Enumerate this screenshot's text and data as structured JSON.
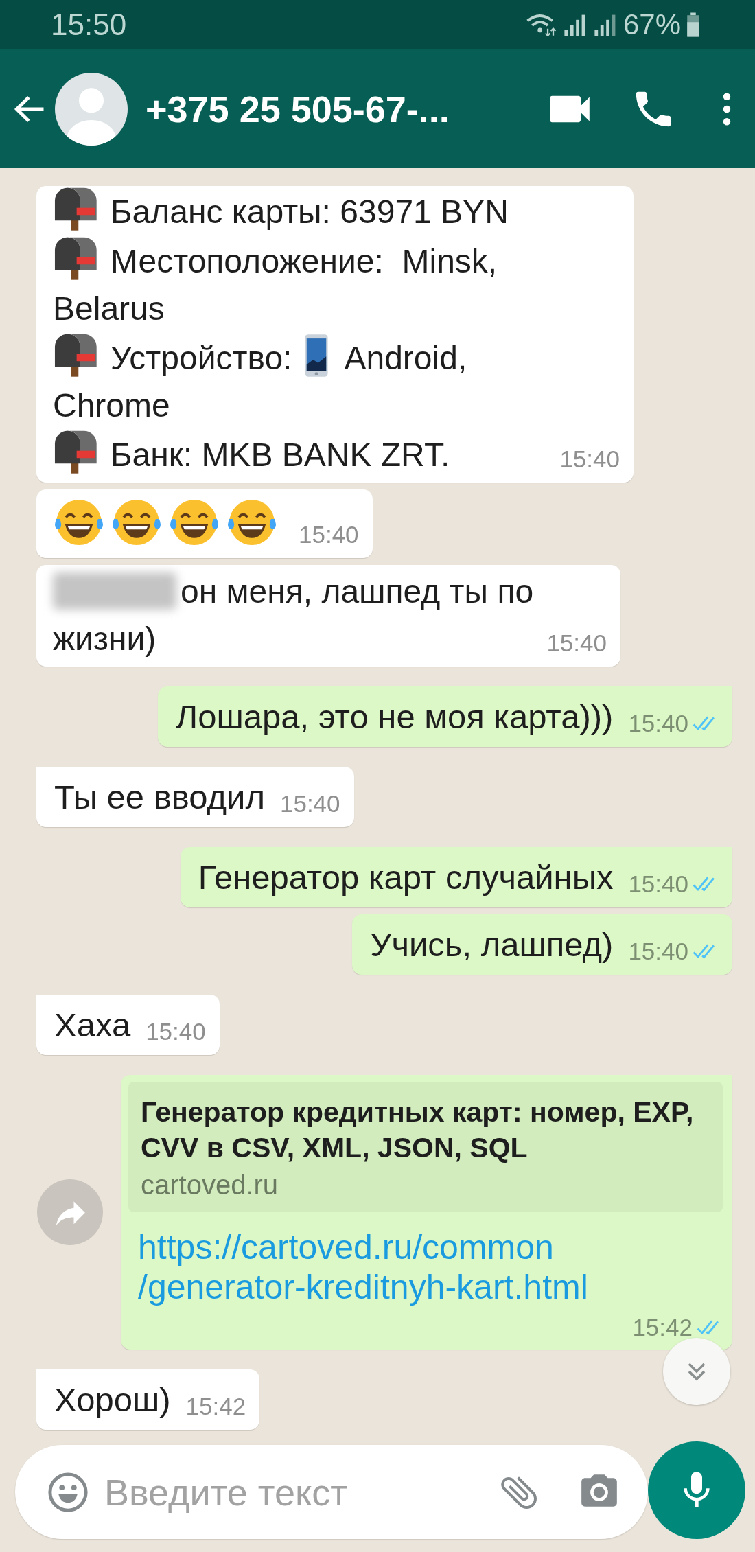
{
  "status_bar": {
    "time": "15:50",
    "battery": "67%"
  },
  "header": {
    "title": "+375 25 505-67-..."
  },
  "messages": [
    {
      "kind": "rich",
      "outgoing": false,
      "tail": false,
      "time": "15:40",
      "lines": [
        {
          "parts": [
            {
              "kind": "mailbox"
            },
            {
              "kind": "text",
              "text": "Баланс карты: 63971 BYN"
            }
          ]
        },
        {
          "parts": [
            {
              "kind": "mailbox"
            },
            {
              "kind": "text",
              "text": "Местоположение:  Minsk,"
            }
          ]
        },
        {
          "parts": [
            {
              "kind": "text",
              "text": "Belarus"
            }
          ]
        },
        {
          "parts": [
            {
              "kind": "mailbox"
            },
            {
              "kind": "text",
              "text": "Устройство:"
            },
            {
              "kind": "phone"
            },
            {
              "kind": "text",
              "text": "Android,"
            }
          ]
        },
        {
          "parts": [
            {
              "kind": "text",
              "text": "Chrome"
            }
          ]
        },
        {
          "parts": [
            {
              "kind": "mailbox"
            },
            {
              "kind": "text",
              "text": "Банк: MKB BANK ZRT."
            }
          ]
        }
      ]
    },
    {
      "kind": "rich",
      "outgoing": false,
      "tail": false,
      "time": "15:40",
      "lines": [
        {
          "parts": [
            {
              "kind": "laugh"
            },
            {
              "kind": "laugh"
            },
            {
              "kind": "laugh"
            },
            {
              "kind": "laugh"
            }
          ]
        }
      ]
    },
    {
      "kind": "rich",
      "outgoing": false,
      "tail": false,
      "time": "15:40",
      "lines": [
        {
          "parts": [
            {
              "kind": "redacted"
            },
            {
              "kind": "text",
              "text": "он меня, лашпед ты по"
            }
          ]
        },
        {
          "parts": [
            {
              "kind": "text",
              "text": "жизни)"
            }
          ]
        }
      ]
    },
    {
      "kind": "text",
      "outgoing": true,
      "tail": true,
      "time": "15:40",
      "read": true,
      "text": "Лошара, это не моя карта)))"
    },
    {
      "kind": "text",
      "outgoing": false,
      "tail": true,
      "time": "15:40",
      "text": "Ты ее вводил"
    },
    {
      "kind": "text",
      "outgoing": true,
      "tail": true,
      "time": "15:40",
      "read": true,
      "text": "Генератор карт случайных"
    },
    {
      "kind": "text",
      "outgoing": true,
      "tail": false,
      "time": "15:40",
      "read": true,
      "text": "Учись, лашпед)"
    },
    {
      "kind": "text",
      "outgoing": false,
      "tail": true,
      "time": "15:40",
      "text": "Хаха"
    },
    {
      "kind": "link",
      "outgoing": true,
      "tail": true,
      "time": "15:42",
      "read": true,
      "preview_title": "Генератор кредитных карт: номер, EXP, CVV в CSV, XML, JSON, SQL",
      "preview_domain": "cartoved.ru",
      "link_lines": [
        "https://cartoved.ru/common",
        "/generator-kreditnyh-kart.html"
      ]
    },
    {
      "kind": "text",
      "outgoing": false,
      "tail": true,
      "time": "15:42",
      "text": "Хорош)"
    }
  ],
  "composer": {
    "placeholder": "Введите текст"
  }
}
